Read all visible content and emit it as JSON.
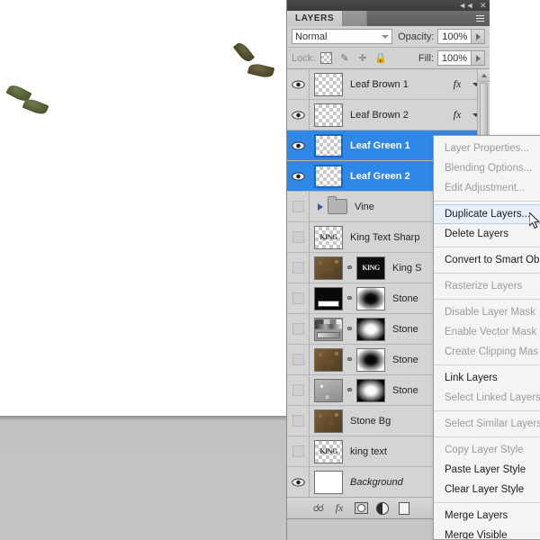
{
  "window": {
    "topbar_collapse_icon": "collapse-to-icons",
    "topbar_close_icon": "close",
    "collapse_glyph": "◄◄",
    "close_glyph": "✕"
  },
  "panel": {
    "tab_label": "LAYERS",
    "menu_icon": "panel-menu-icon",
    "blend_mode": "Normal",
    "opacity_label": "Opacity:",
    "opacity_value": "100%",
    "fill_label": "Fill:",
    "fill_value": "100%",
    "lock_label": "Lock:",
    "lock_icons": [
      "lock-transparent-pixels",
      "lock-image-pixels",
      "lock-position",
      "lock-all"
    ],
    "lock_all_glyph": "🔒",
    "lock_position_glyph": "✛",
    "lock_brush_glyph": "✎",
    "selection_accent": "#2f87e8"
  },
  "layers": [
    {
      "name": "Leaf Brown 1",
      "visible": true,
      "selected": false,
      "thumb": "checker",
      "has_fx": true,
      "has_mask": false,
      "is_group": false,
      "italic": false
    },
    {
      "name": "Leaf Brown 2",
      "visible": true,
      "selected": false,
      "thumb": "checker",
      "has_fx": true,
      "has_mask": false,
      "is_group": false,
      "italic": false
    },
    {
      "name": "Leaf Green 1",
      "visible": true,
      "selected": true,
      "thumb": "checker",
      "has_fx": false,
      "has_mask": false,
      "is_group": false,
      "italic": false
    },
    {
      "name": "Leaf Green 2",
      "visible": true,
      "selected": true,
      "thumb": "checker",
      "has_fx": false,
      "has_mask": false,
      "is_group": false,
      "italic": false
    },
    {
      "name": "Vine",
      "visible": false,
      "selected": false,
      "thumb": "folder",
      "has_fx": false,
      "has_mask": false,
      "is_group": true,
      "italic": false
    },
    {
      "name": "King Text Sharp",
      "visible": false,
      "selected": false,
      "thumb": "kingtext",
      "has_fx": false,
      "has_mask": false,
      "is_group": false,
      "italic": false
    },
    {
      "name": "King S",
      "visible": false,
      "selected": false,
      "thumb": "dirt",
      "has_fx": false,
      "has_mask": true,
      "mask": "kingdark",
      "is_group": false,
      "italic": false
    },
    {
      "name": "Stone",
      "visible": false,
      "selected": false,
      "thumb": "blackmask",
      "has_fx": false,
      "has_mask": true,
      "mask": "maskdark",
      "is_group": false,
      "italic": false
    },
    {
      "name": "Stone",
      "visible": false,
      "selected": false,
      "thumb": "gradbars",
      "has_fx": false,
      "has_mask": true,
      "mask": "masklight",
      "is_group": false,
      "italic": false
    },
    {
      "name": "Stone",
      "visible": false,
      "selected": false,
      "thumb": "dirt",
      "has_fx": false,
      "has_mask": true,
      "mask": "maskdark",
      "is_group": false,
      "italic": false
    },
    {
      "name": "Stone",
      "visible": false,
      "selected": false,
      "thumb": "gravel",
      "has_fx": false,
      "has_mask": true,
      "mask": "masklight",
      "is_group": false,
      "italic": false
    },
    {
      "name": "Stone Bg",
      "visible": false,
      "selected": false,
      "thumb": "dirt",
      "has_fx": false,
      "has_mask": false,
      "is_group": false,
      "italic": false
    },
    {
      "name": "king text",
      "visible": false,
      "selected": false,
      "thumb": "kingtext",
      "has_fx": false,
      "has_mask": false,
      "is_group": false,
      "italic": false
    },
    {
      "name": "Background",
      "visible": true,
      "selected": false,
      "thumb": "white",
      "has_fx": false,
      "has_mask": false,
      "is_group": false,
      "italic": true
    }
  ],
  "layer_thumb_text": {
    "king": "KING"
  },
  "panel_bottom_icons": [
    {
      "name": "link-layers-icon"
    },
    {
      "name": "add-layer-style-icon",
      "glyph": "fx"
    },
    {
      "name": "add-layer-mask-icon"
    },
    {
      "name": "new-adjustment-layer-icon"
    },
    {
      "name": "new-group-icon"
    }
  ],
  "context_menu": {
    "items": [
      {
        "label": "Layer Properties...",
        "disabled": true,
        "hover": false,
        "sep_after": false
      },
      {
        "label": "Blending Options...",
        "disabled": true,
        "hover": false,
        "sep_after": false
      },
      {
        "label": "Edit Adjustment...",
        "disabled": true,
        "hover": false,
        "sep_after": true
      },
      {
        "label": "Duplicate Layers...",
        "disabled": false,
        "hover": true,
        "sep_after": false
      },
      {
        "label": "Delete Layers",
        "disabled": false,
        "hover": false,
        "sep_after": true
      },
      {
        "label": "Convert to Smart Ob",
        "disabled": false,
        "hover": false,
        "sep_after": true
      },
      {
        "label": "Rasterize Layers",
        "disabled": true,
        "hover": false,
        "sep_after": true
      },
      {
        "label": "Disable Layer Mask",
        "disabled": true,
        "hover": false,
        "sep_after": false
      },
      {
        "label": "Enable Vector Mask",
        "disabled": true,
        "hover": false,
        "sep_after": false
      },
      {
        "label": "Create Clipping Mas",
        "disabled": true,
        "hover": false,
        "sep_after": true
      },
      {
        "label": "Link Layers",
        "disabled": false,
        "hover": false,
        "sep_after": false
      },
      {
        "label": "Select Linked Layers",
        "disabled": true,
        "hover": false,
        "sep_after": true
      },
      {
        "label": "Select Similar Layers",
        "disabled": true,
        "hover": false,
        "sep_after": true
      },
      {
        "label": "Copy Layer Style",
        "disabled": true,
        "hover": false,
        "sep_after": false
      },
      {
        "label": "Paste Layer Style",
        "disabled": false,
        "hover": false,
        "sep_after": false
      },
      {
        "label": "Clear Layer Style",
        "disabled": false,
        "hover": false,
        "sep_after": true
      },
      {
        "label": "Merge Layers",
        "disabled": false,
        "hover": false,
        "sep_after": false
      },
      {
        "label": "Merge Visible",
        "disabled": false,
        "hover": false,
        "sep_after": false
      }
    ]
  },
  "canvas": {
    "leaves": [
      "leaf-green-1",
      "leaf-green-2",
      "leaf-brown-1",
      "leaf-brown-2"
    ],
    "background_color": "#ffffff",
    "lower_band_color": "#c4c4c4"
  },
  "cursor": {
    "name": "mouse-pointer"
  }
}
